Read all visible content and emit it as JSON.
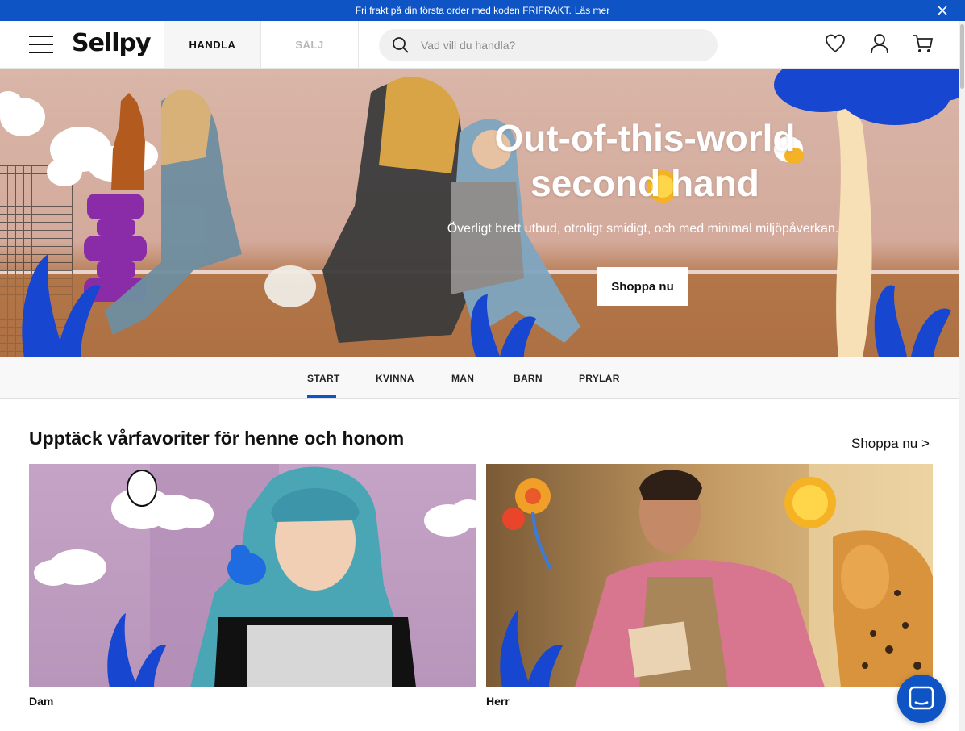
{
  "promo": {
    "text": "Fri frakt på din första order med koden FRIFRAKT.",
    "link": "Läs mer",
    "close_icon": "close-icon"
  },
  "header": {
    "logo": "Sellpy",
    "menu_icon": "hamburger-menu-icon",
    "modes": [
      "HANDLA",
      "SÄLJ"
    ],
    "active_mode": "HANDLA",
    "search": {
      "placeholder": "Vad vill du handla?",
      "value": "",
      "icon": "search-icon"
    },
    "icons": [
      "heart-icon",
      "user-icon",
      "cart-icon"
    ]
  },
  "hero": {
    "title": "Out-of-this-world second hand",
    "subtitle": "Överligt brett utbud, otroligt smidigt, och med minimal miljöpåverkan.",
    "cta": "Shoppa nu"
  },
  "category_nav": {
    "tabs": [
      "START",
      "KVINNA",
      "MAN",
      "BARN",
      "PRYLAR"
    ],
    "active": "START"
  },
  "section": {
    "title": "Upptäck vårfavoriter för henne och honom",
    "link": "Shoppa nu >",
    "cards": [
      {
        "label": "Dam"
      },
      {
        "label": "Herr"
      }
    ]
  },
  "colors": {
    "brand_blue": "#0f54c4",
    "text": "#111111"
  },
  "chat_icon": "chat-bubble-icon"
}
